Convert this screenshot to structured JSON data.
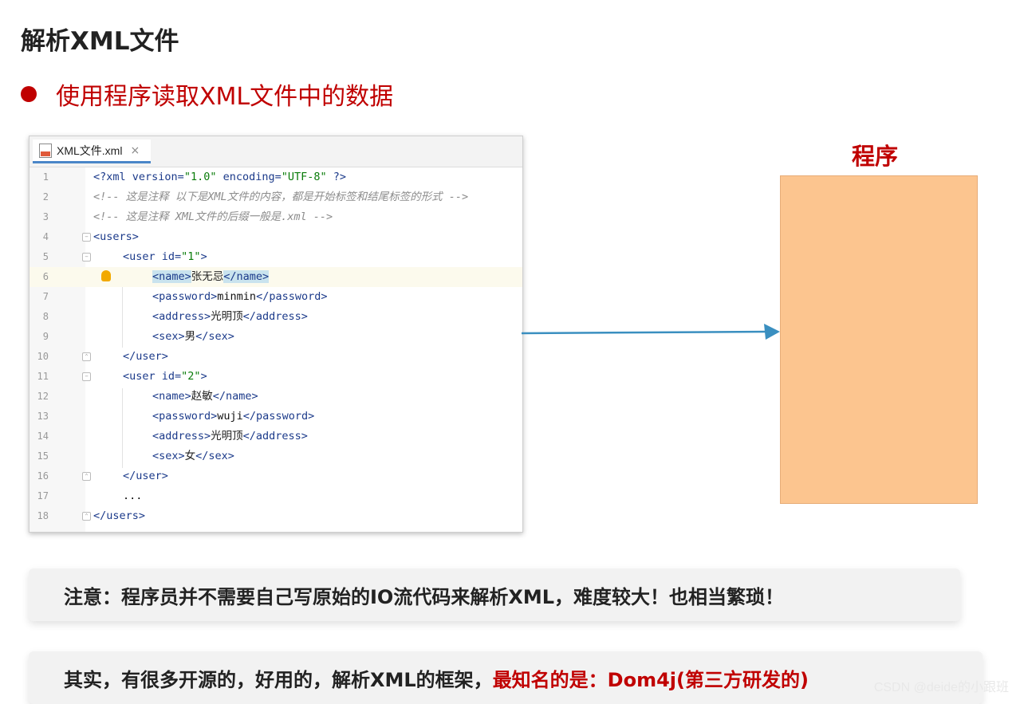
{
  "slide": {
    "title": "解析XML文件",
    "bullet": "使用程序读取XML文件中的数据"
  },
  "editor": {
    "tab_label": "XML文件.xml",
    "tab_close": "×",
    "lines": [
      "1",
      "2",
      "3",
      "4",
      "5",
      "6",
      "7",
      "8",
      "9",
      "10",
      "11",
      "12",
      "13",
      "14",
      "15",
      "16",
      "17",
      "18"
    ],
    "code": {
      "l1_decl_open": "<?xml ",
      "l1_version_attr": "version=",
      "l1_version_val": "\"1.0\"",
      "l1_encoding_attr": " encoding=",
      "l1_encoding_val": "\"UTF-8\"",
      "l1_decl_close": " ?>",
      "l2_comment": "<!-- 这是注释 以下是XML文件的内容，都是开始标签和结尾标签的形式 -->",
      "l3_comment": "<!-- 这是注释 XML文件的后缀一般是.xml -->",
      "l4": "<users>",
      "l5_open": "<user ",
      "l5_attr": "id=",
      "l5_val": "\"1\"",
      "l5_close": ">",
      "l6_open": "<name>",
      "l6_text": "张无忌",
      "l6_close": "</name>",
      "l7_open": "<password>",
      "l7_text": "minmin",
      "l7_close": "</password>",
      "l8_open": "<address>",
      "l8_text": "光明顶",
      "l8_close": "</address>",
      "l9_open": "<sex>",
      "l9_text": "男",
      "l9_close": "</sex>",
      "l10": "</user>",
      "l11_open": "<user ",
      "l11_attr": "id=",
      "l11_val": "\"2\"",
      "l11_close": ">",
      "l12_open": "<name>",
      "l12_text": "赵敏",
      "l12_close": "</name>",
      "l13_open": "<password>",
      "l13_text": "wuji",
      "l13_close": "</password>",
      "l14_open": "<address>",
      "l14_text": "光明顶",
      "l14_close": "</address>",
      "l15_open": "<sex>",
      "l15_text": "女",
      "l15_close": "</sex>",
      "l16": "</user>",
      "l17": "...",
      "l18": "</users>"
    }
  },
  "program": {
    "label": "程序"
  },
  "notes": {
    "note1": "注意：程序员并不需要自己写原始的IO流代码来解析XML，难度较大！也相当繁琐！",
    "note2_black": "其实，有很多开源的，好用的，解析XML的框架，",
    "note2_red": "最知名的是：Dom4j(第三方研发的)"
  },
  "watermark": "CSDN @deide的小跟班",
  "colors": {
    "accent_red": "#c00000",
    "program_box": "#fcc58f",
    "arrow": "#3a8fc0"
  }
}
